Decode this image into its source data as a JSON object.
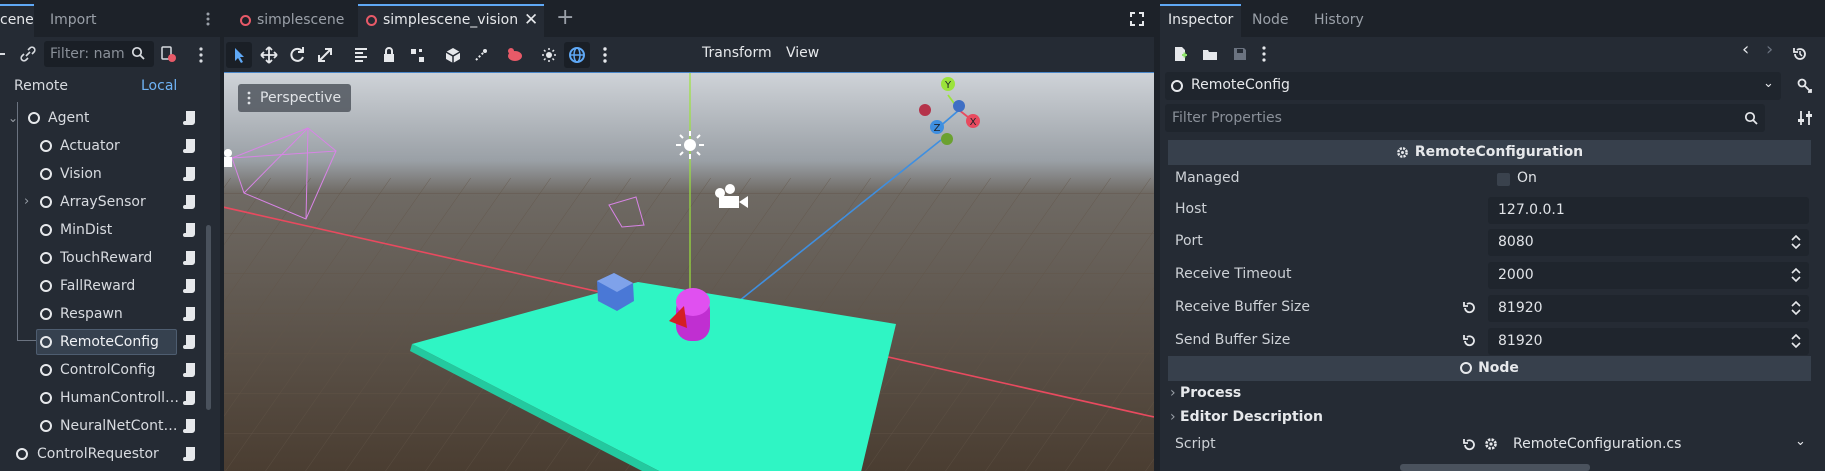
{
  "left_panel": {
    "tabs": [
      "cene",
      "Import"
    ],
    "filter_placeholder": "Filter: nam",
    "remote_label": "Remote",
    "local_label": "Local",
    "tree": [
      {
        "label": "Agent",
        "depth": 1,
        "expanded": true
      },
      {
        "label": "Actuator",
        "depth": 2
      },
      {
        "label": "Vision",
        "depth": 2
      },
      {
        "label": "ArraySensor",
        "depth": 2,
        "collapsed": true
      },
      {
        "label": "MinDist",
        "depth": 2
      },
      {
        "label": "TouchReward",
        "depth": 2
      },
      {
        "label": "FallReward",
        "depth": 2
      },
      {
        "label": "Respawn",
        "depth": 2
      },
      {
        "label": "RemoteConfig",
        "depth": 2,
        "selected": true
      },
      {
        "label": "ControlConfig",
        "depth": 2
      },
      {
        "label": "HumanControll…",
        "depth": 2
      },
      {
        "label": "NeuralNetCont…",
        "depth": 2
      },
      {
        "label": "ControlRequestor",
        "depth": 1
      }
    ]
  },
  "viewport": {
    "tabs": [
      "simplescene",
      "simplescene_vision"
    ],
    "active_tab": "simplescene_vision",
    "menus": [
      "Transform",
      "View"
    ],
    "perspective_label": "Perspective",
    "gizmo_labels": {
      "y": "Y",
      "x": "X",
      "z": "Z"
    }
  },
  "inspector": {
    "tabs": [
      "Inspector",
      "Node",
      "History"
    ],
    "object_name": "RemoteConfig",
    "filter_placeholder": "Filter Properties",
    "section_title": "RemoteConfiguration",
    "properties": [
      {
        "name": "Managed",
        "value": "On",
        "type": "checkbox"
      },
      {
        "name": "Host",
        "value": "127.0.0.1",
        "type": "text"
      },
      {
        "name": "Port",
        "value": "8080",
        "type": "spin"
      },
      {
        "name": "Receive Timeout",
        "value": "2000",
        "type": "spin"
      },
      {
        "name": "Receive Buffer Size",
        "value": "81920",
        "type": "spin",
        "revert": true
      },
      {
        "name": "Send Buffer Size",
        "value": "81920",
        "type": "spin",
        "revert": true
      }
    ],
    "node_section_title": "Node",
    "categories": [
      "Process",
      "Editor Description"
    ],
    "script_label": "Script",
    "script_value": "RemoteConfiguration.cs"
  },
  "colors": {
    "accent": "#5fa8f5",
    "ground": "#2ff5c4",
    "sphere": "#c02fd1",
    "cube": "#4a78d6",
    "x_axis": "#e84a5f",
    "z_axis": "#3f8fe0",
    "y_axis": "#9be33b"
  }
}
